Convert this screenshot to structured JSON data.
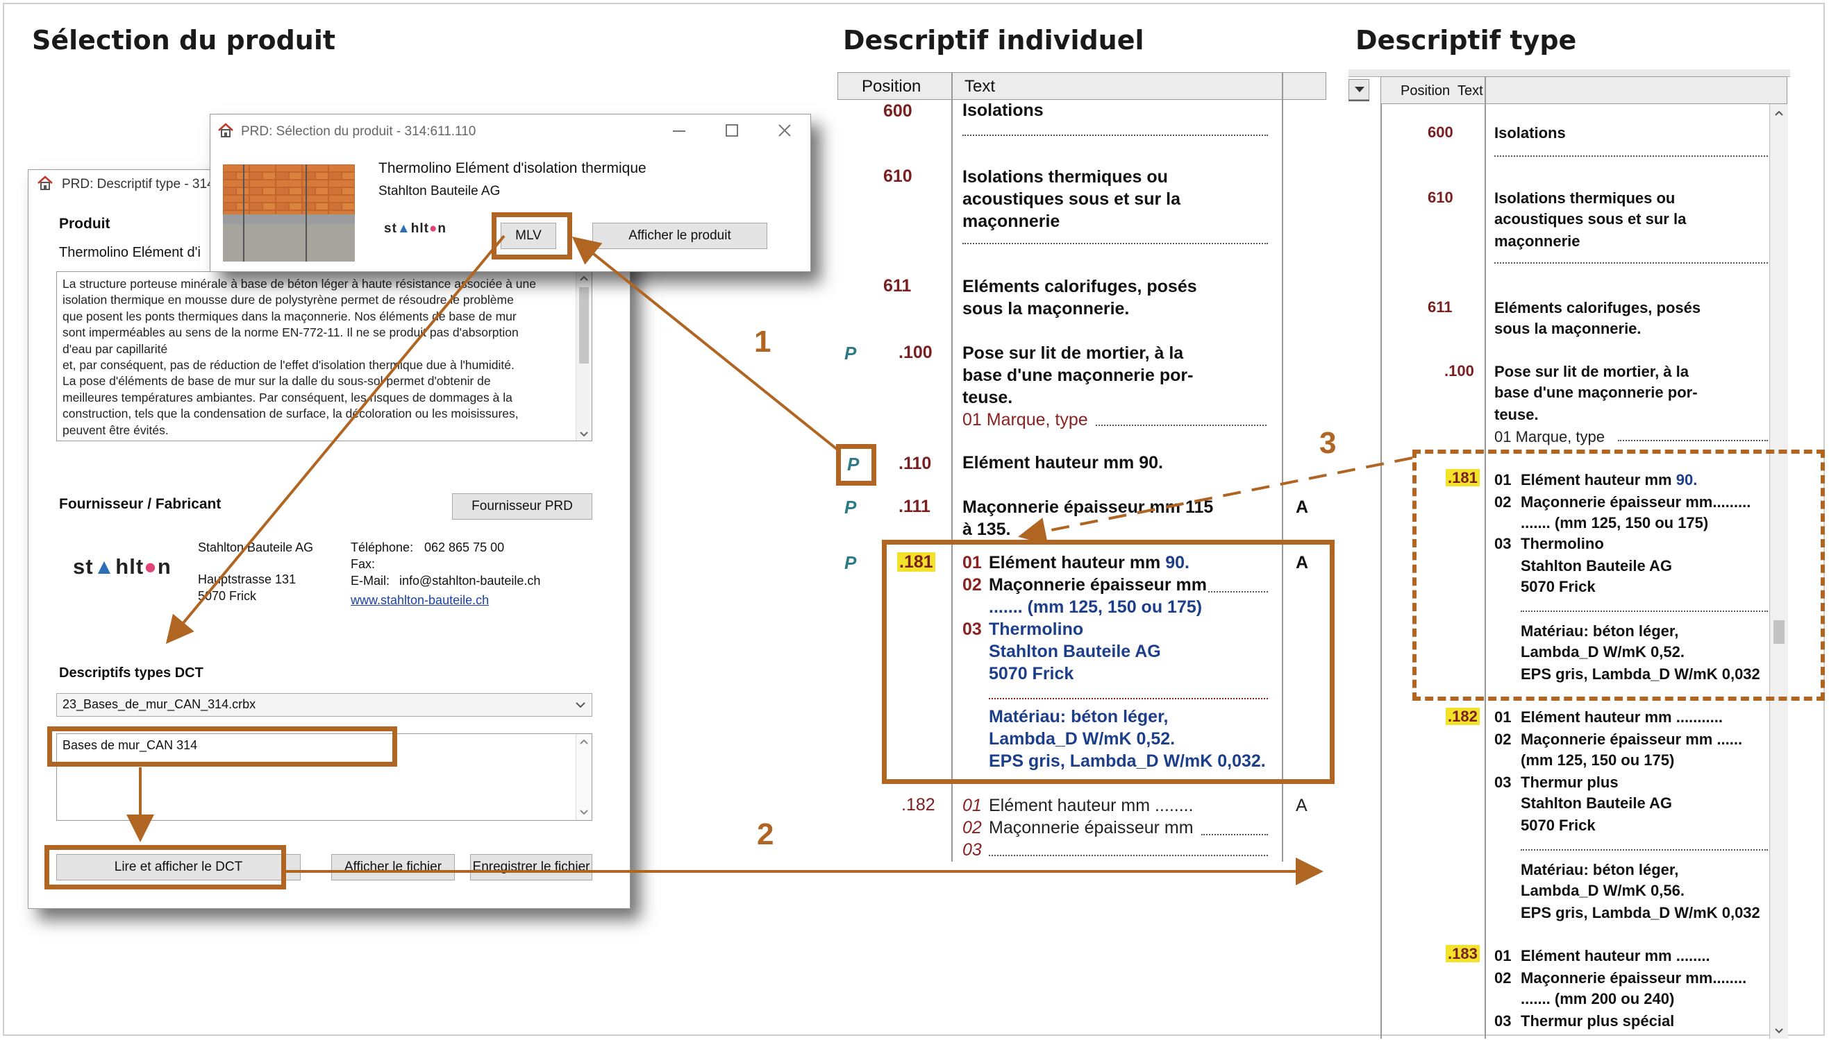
{
  "headings": {
    "left": "Sélection du produit",
    "middle": "Descriptif individuel",
    "right": "Descriptif type"
  },
  "colors": {
    "highlight": "#b06522",
    "marker": "#f2e22a",
    "text_blue": "#1d3e8a",
    "text_red": "#7a1f1f"
  },
  "back_window": {
    "title": "PRD:  Descriptif type - 314",
    "produit_label": "Produit",
    "produit_name": "Thermolino Elément d'i",
    "description_lines": [
      "La structure porteuse minérale à base de béton léger à haute résistance associée à une",
      "isolation thermique en mousse dure de polystyrène permet de résoudre le problème",
      "que posent les ponts thermiques dans la maçonnerie. Nos éléments de base de mur",
      "sont imperméables au sens de la norme EN-772-11. Il ne se produit pas d'absorption",
      "d'eau par capillarité",
      "et, par conséquent, pas de réduction de l'effet d'isolation thermique due à l'humidité.",
      "La pose d'éléments de base de mur sur la dalle du sous-sol permet d'obtenir de",
      "meilleures températures ambiantes. Par conséquent, les risques de dommages à la",
      "construction,  tels que la condensation de surface, la décoloration ou les moisissures,",
      "peuvent être évités."
    ],
    "supplier_label": "Fournisseur / Fabricant",
    "supplier_button": "Fournisseur PRD",
    "logo": "stahlton",
    "company": "Stahlton Bauteile AG",
    "street": "Hauptstrasse 131",
    "city": "5070 Frick",
    "phone_label": "Téléphone:",
    "phone": "062 865 75 00",
    "fax_label": "Fax:",
    "email_label": "E-Mail:",
    "email": "info@stahlton-bauteile.ch",
    "website": "www.stahlton-bauteile.ch",
    "dct_label": "Descriptifs types DCT",
    "dct_file": "23_Bases_de_mur_CAN_314.crbx",
    "dct_item": "Bases de mur_CAN 314",
    "btn_read": "Lire et afficher le DCT",
    "btn_show_file": "Afficher le fichier",
    "btn_save_file": "Enregistrer le fichier"
  },
  "front_window": {
    "title": "PRD:  Sélection du produit  -  314:611.110",
    "product_name": "Thermolino Elément d'isolation thermique",
    "manufacturer": "Stahlton Bauteile AG",
    "logo": "stahlton",
    "btn_mlv": "MLV",
    "btn_show_product": "Afficher le produit"
  },
  "callouts": {
    "one": "1",
    "two": "2",
    "three": "3"
  },
  "individual": {
    "col_position": "Position",
    "col_text": "Text",
    "p_marker": "P",
    "rows": {
      "r600": {
        "pos": "600",
        "text": "Isolations"
      },
      "r610": {
        "pos": "610",
        "l1": "Isolations thermiques ou",
        "l2": "acoustiques sous et sur la",
        "l3": "maçonnerie"
      },
      "r611": {
        "pos": "611",
        "l1": "Eléments calorifuges, posés",
        "l2": "sous la maçonnerie."
      },
      "r100": {
        "pos": ".100",
        "l1": "Pose sur lit de mortier, à la",
        "l2": "base d'une maçonnerie por-",
        "l3": "teuse.",
        "l4": "01  Marque, type"
      },
      "r110": {
        "pos": ".110",
        "text": "Elément hauteur mm 90."
      },
      "r111": {
        "pos": ".111",
        "l1": "Maçonnerie épaisseur mm 115",
        "l2": "à 135.",
        "flag": "A"
      },
      "r181": {
        "pos": ".181",
        "flag": "A",
        "n01": "01",
        "l01a": "Elément hauteur mm ",
        "l01b": "90.",
        "n02": "02",
        "l02": "Maçonnerie épaisseur mm",
        "l02b": "....... (mm 125, 150 ou 175)",
        "n03": "03",
        "l03a": "Thermolino",
        "l03b": "Stahlton Bauteile AG",
        "l03c": "5070 Frick",
        "m1": "Matériau: béton léger,",
        "m2": "Lambda_D W/mK 0,52.",
        "m3": "EPS gris, Lambda_D W/mK 0,032."
      },
      "r182": {
        "pos": ".182",
        "flag": "A",
        "n01": "01",
        "l01": "Elément hauteur mm ........",
        "n02": "02",
        "l02": "Maçonnerie épaisseur mm",
        "n03": "03"
      }
    }
  },
  "type": {
    "col_position": "Position",
    "col_text": "Text",
    "rows": {
      "r600": {
        "pos": "600",
        "text": "Isolations"
      },
      "r610": {
        "pos": "610",
        "l1": "Isolations thermiques ou",
        "l2": "acoustiques sous et sur la",
        "l3": "maçonnerie"
      },
      "r611": {
        "pos": "611",
        "l1": "Eléments calorifuges, posés",
        "l2": "sous la maçonnerie."
      },
      "r100": {
        "pos": ".100",
        "l1": "Pose sur lit de mortier, à la",
        "l2": "base d'une maçonnerie por-",
        "l3": "teuse.",
        "l4": "01  Marque, type"
      },
      "r181": {
        "pos": ".181",
        "n01": "01",
        "l01a": "Elément hauteur mm ",
        "l01b": "90.",
        "n02": "02",
        "l02": "Maçonnerie épaisseur mm.........",
        "l02b": "....... (mm 125, 150 ou 175)",
        "n03": "03",
        "l03a": "Thermolino",
        "l03b": "Stahlton Bauteile AG",
        "l03c": "5070 Frick",
        "m1": "Matériau: béton léger,",
        "m2": "Lambda_D W/mK 0,52.",
        "m3": "EPS gris, Lambda_D W/mK 0,032"
      },
      "r182": {
        "pos": ".182",
        "n01": "01",
        "l01": "Elément hauteur mm ...........",
        "n02": "02",
        "l02": "Maçonnerie épaisseur mm ......",
        "l02b": "(mm 125, 150 ou 175)",
        "n03": "03",
        "l03a": "Thermur plus",
        "l03b": "Stahlton Bauteile AG",
        "l03c": "5070 Frick",
        "m1": "Matériau: béton léger,",
        "m2": "Lambda_D W/mK 0,56.",
        "m3": "EPS gris, Lambda_D W/mK 0,032"
      },
      "r183": {
        "pos": ".183",
        "n01": "01",
        "l01": "Elément hauteur mm ........",
        "n02": "02",
        "l02": "Maçonnerie épaisseur mm........",
        "l02b": "....... (mm 200 ou 240)",
        "n03": "03",
        "l03": "Thermur plus spécial"
      }
    }
  }
}
